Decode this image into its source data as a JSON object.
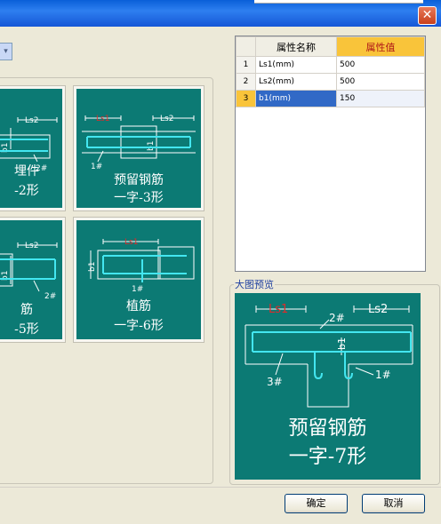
{
  "window": {
    "close_glyph": "✕"
  },
  "combo": {
    "arrow_glyph": "▾"
  },
  "gallery": {
    "cards": [
      {
        "line1": "埋件",
        "line2": "-2形"
      },
      {
        "line1": "预留钢筋",
        "line2": "一字-3形"
      },
      {
        "line1": "筋",
        "line2": "-5形"
      },
      {
        "line1": "植筋",
        "line2": "一字-6形"
      }
    ]
  },
  "grid": {
    "headers": [
      "",
      "属性名称",
      "属性值"
    ],
    "rows": [
      {
        "num": "1",
        "name": "Ls1(mm)",
        "value": "500"
      },
      {
        "num": "2",
        "name": "Ls2(mm)",
        "value": "500"
      },
      {
        "num": "3",
        "name": "b1(mm)",
        "value": "150"
      }
    ]
  },
  "preview": {
    "label": "大图预览",
    "title_line1": "预留钢筋",
    "title_line2": "一字-7形"
  },
  "buttons": {
    "ok": "确定",
    "cancel": "取消"
  },
  "colors": {
    "canvas": "#0c7a74",
    "rebar": "#43e6f0",
    "accent": "#e02a2a",
    "header_highlight": "#f9c43a"
  }
}
